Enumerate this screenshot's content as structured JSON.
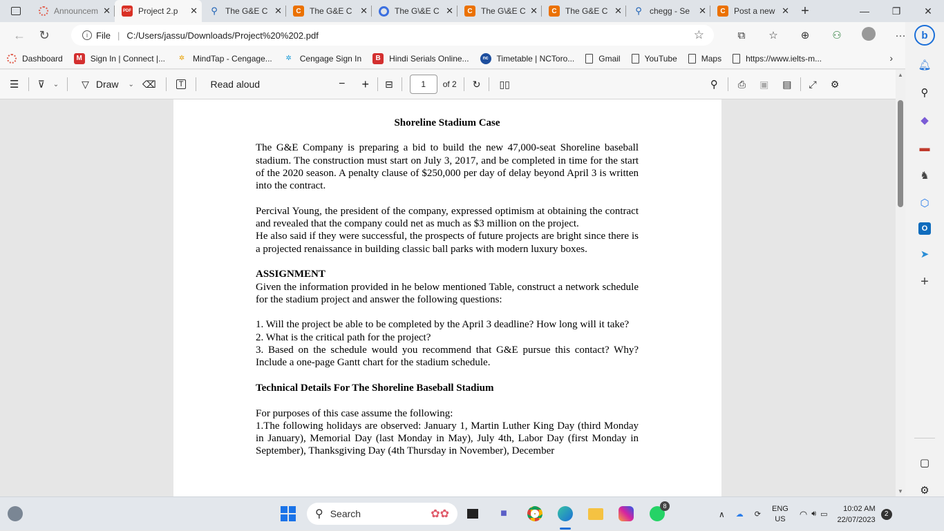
{
  "tabs": [
    {
      "label": "Announcem",
      "icon": "loading-icon"
    },
    {
      "label": "Project 2.p",
      "icon": "pdf-icon",
      "active": true
    },
    {
      "label": "The G&E C",
      "icon": "search-icon"
    },
    {
      "label": "The G&E C",
      "icon": "chegg-icon"
    },
    {
      "label": "The G\\&E C",
      "icon": "search-icon"
    },
    {
      "label": "The G\\&E C",
      "icon": "chegg-icon"
    },
    {
      "label": "The G&E C",
      "icon": "chegg-icon"
    },
    {
      "label": "chegg - Se",
      "icon": "search-icon"
    },
    {
      "label": "Post a new",
      "icon": "chegg-icon"
    }
  ],
  "address": {
    "scheme_label": "File",
    "url": "C:/Users/jassu/Downloads/Project%20%202.pdf"
  },
  "bookmarks": [
    {
      "label": "Dashboard"
    },
    {
      "label": "Sign In | Connect |..."
    },
    {
      "label": "MindTap - Cengage..."
    },
    {
      "label": "Cengage Sign In"
    },
    {
      "label": "Hindi Serials Online..."
    },
    {
      "label": "Timetable | NCToro..."
    },
    {
      "label": "Gmail"
    },
    {
      "label": "YouTube"
    },
    {
      "label": "Maps"
    },
    {
      "label": "https://www.ielts-m..."
    }
  ],
  "pdf_toolbar": {
    "draw_label": "Draw",
    "read_aloud_label": "Read aloud",
    "page_number": "1",
    "page_total": "of 2"
  },
  "document": {
    "title": "Shoreline Stadium Case",
    "p1": "The G&E Company is preparing a bid to build the new 47,000-seat Shoreline baseball stadium. The construction must start on July 3, 2017, and be completed in time for the start of the 2020 season. A penalty clause of $250,000 per day of delay beyond April 3 is written into the contract.",
    "p2": "Percival Young, the president of the company, expressed optimism at obtaining the contract and revealed that the company could net as much as $3 million on the project.",
    "p3": "He also said if they were successful, the prospects of future projects are bright since there is a projected renaissance in building classic ball parks with modern luxury boxes.",
    "assignment_heading": "ASSIGNMENT",
    "p4": "Given the information provided in he below mentioned Table, construct a network schedule for the stadium project and answer the following questions:",
    "q1": "1. Will the project be able to be completed by the April 3 deadline? How long will it take?",
    "q2": "2. What is the critical path for the project?",
    "q3": "3. Based on the schedule would you recommend that G&E pursue this contact? Why? Include a one-page Gantt chart for the stadium schedule.",
    "tech_heading": "Technical Details For The Shoreline Baseball Stadium",
    "p5": "For purposes of this case assume the following:",
    "p6": "1.The following holidays are observed: January 1, Martin Luther King Day (third Monday in January), Memorial Day (last Monday in May), July 4th, Labor Day (first Monday in September), Thanksgiving Day (4th Thursday in November), December"
  },
  "taskbar": {
    "search_label": "Search",
    "whatsapp_badge": "8",
    "lang_top": "ENG",
    "lang_bottom": "US",
    "time": "10:02 AM",
    "date": "22/07/2023",
    "notif_count": "2"
  }
}
